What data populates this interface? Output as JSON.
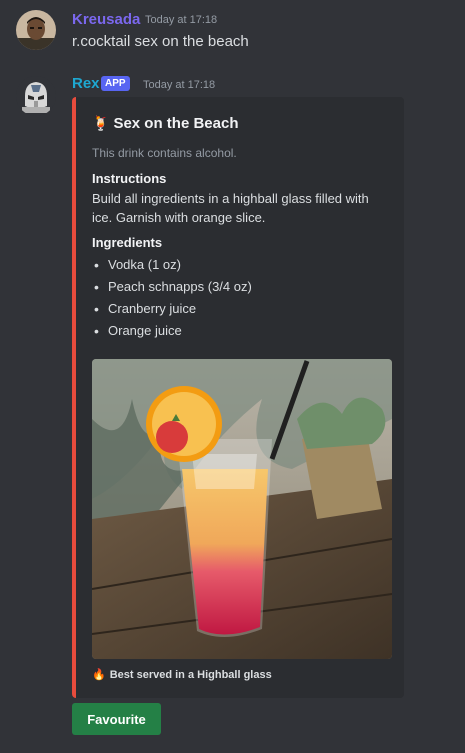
{
  "messages": [
    {
      "author": "Kreusada",
      "author_color": "#7b68ee",
      "timestamp": "Today at 17:18",
      "content": "r.cocktail sex on the beach"
    },
    {
      "author": "Rex",
      "author_color": "#1ea7d0",
      "badge": "APP",
      "timestamp": "Today at 17:18"
    }
  ],
  "embed": {
    "accent_color": "#e84c3d",
    "title": "Sex on the Beach",
    "title_icon": "tropical-drink-emoji",
    "description": "This drink contains alcohol.",
    "instructions_label": "Instructions",
    "instructions_text": "Build all ingredients in a highball glass filled with ice. Garnish with orange slice.",
    "ingredients_label": "Ingredients",
    "ingredients": [
      "Vodka (1 oz)",
      "Peach schnapps (3/4 oz)",
      "Cranberry juice",
      "Orange juice"
    ],
    "footer_icon": "fire-emoji",
    "footer_text": "Best served in a Highball glass"
  },
  "buttons": {
    "favourite_label": "Favourite"
  }
}
